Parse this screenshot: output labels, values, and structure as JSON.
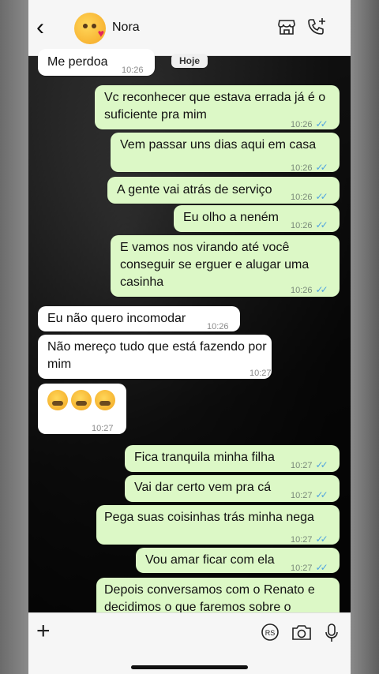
{
  "header": {
    "back_glyph": "‹",
    "contact_name": "Nora"
  },
  "date_chip": "Hoje",
  "messages": [
    {
      "dir": "in",
      "text": "Me perdoa",
      "time": "10:26"
    },
    {
      "dir": "out",
      "text": "Vc reconhecer que estava errada já é o suficiente pra mim",
      "time": "10:26"
    },
    {
      "dir": "out",
      "text": "Vem passar uns dias aqui em casa",
      "time": "10:26"
    },
    {
      "dir": "out",
      "text": "A gente vai atrás de serviço",
      "time": "10:26"
    },
    {
      "dir": "out",
      "text": "Eu olho a neném",
      "time": "10:26"
    },
    {
      "dir": "out",
      "text": "E vamos nos virando até você conseguir se erguer e alugar uma casinha",
      "time": "10:26"
    },
    {
      "dir": "in",
      "text": "Eu não quero incomodar",
      "time": "10:26"
    },
    {
      "dir": "in",
      "text": "Não mereço tudo que está fazendo por mim",
      "time": "10:27"
    },
    {
      "dir": "in",
      "text": "",
      "time": "10:27",
      "emoji": "crying-face x3"
    },
    {
      "dir": "out",
      "text": "Fica tranquila minha filha",
      "time": "10:27"
    },
    {
      "dir": "out",
      "text": "Vai dar certo vem pra cá",
      "time": "10:27"
    },
    {
      "dir": "out",
      "text": "Pega suas coisinhas trás minha nega",
      "time": "10:27"
    },
    {
      "dir": "out",
      "text": "Vou amar ficar com ela",
      "time": "10:27"
    },
    {
      "dir": "out",
      "text": "Depois conversamos com o Renato e decidimos o que faremos sobre o",
      "time": ""
    }
  ],
  "footer": {
    "plus_glyph": "+",
    "icons": [
      "plus-icon",
      "sticker-icon",
      "camera-icon",
      "microphone-icon"
    ]
  },
  "colors": {
    "outgoing_bubble": "#dcf8c6",
    "incoming_bubble": "#ffffff",
    "read_ticks": "#4fa3e0"
  }
}
